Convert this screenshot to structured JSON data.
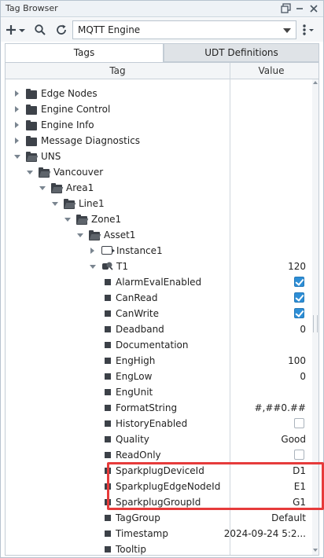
{
  "window": {
    "title": "Tag Browser"
  },
  "toolbar": {
    "provider": "MQTT Engine"
  },
  "tabs": [
    "Tags",
    "UDT Definitions"
  ],
  "columns": {
    "tag": "Tag",
    "value": "Value"
  },
  "colors": {
    "accent": "#2d8ed6",
    "highlight": "#e63b3b"
  },
  "tree": [
    {
      "label": "Edge Nodes",
      "level": 0,
      "icon": "folder-icon",
      "state": "collapsed",
      "value": ""
    },
    {
      "label": "Engine Control",
      "level": 0,
      "icon": "folder-icon",
      "state": "collapsed",
      "value": ""
    },
    {
      "label": "Engine Info",
      "level": 0,
      "icon": "folder-icon",
      "state": "collapsed",
      "value": ""
    },
    {
      "label": "Message Diagnostics",
      "level": 0,
      "icon": "folder-icon",
      "state": "collapsed",
      "value": ""
    },
    {
      "label": "UNS",
      "level": 0,
      "icon": "folder-open-icon",
      "state": "expanded",
      "value": ""
    },
    {
      "label": "Vancouver",
      "level": 1,
      "icon": "folder-open-icon",
      "state": "expanded",
      "value": ""
    },
    {
      "label": "Area1",
      "level": 2,
      "icon": "folder-open-icon",
      "state": "expanded",
      "value": ""
    },
    {
      "label": "Line1",
      "level": 3,
      "icon": "folder-open-icon",
      "state": "expanded",
      "value": ""
    },
    {
      "label": "Zone1",
      "level": 4,
      "icon": "folder-open-icon",
      "state": "expanded",
      "value": ""
    },
    {
      "label": "Asset1",
      "level": 5,
      "icon": "folder-open-icon",
      "state": "expanded",
      "value": ""
    },
    {
      "label": "Instance1",
      "level": 6,
      "icon": "udt-instance-icon",
      "state": "collapsed",
      "value": ""
    },
    {
      "label": "T1",
      "level": 6,
      "icon": "tag-expanded-icon",
      "state": "expanded",
      "value": "120"
    },
    {
      "label": "AlarmEvalEnabled",
      "level": 7,
      "icon": "property-icon",
      "state": "leaf",
      "check": true
    },
    {
      "label": "CanRead",
      "level": 7,
      "icon": "property-icon",
      "state": "leaf",
      "check": true
    },
    {
      "label": "CanWrite",
      "level": 7,
      "icon": "property-icon",
      "state": "leaf",
      "check": true
    },
    {
      "label": "Deadband",
      "level": 7,
      "icon": "property-icon",
      "state": "leaf",
      "value": "0"
    },
    {
      "label": "Documentation",
      "level": 7,
      "icon": "property-icon",
      "state": "leaf",
      "value": ""
    },
    {
      "label": "EngHigh",
      "level": 7,
      "icon": "property-icon",
      "state": "leaf",
      "value": "100"
    },
    {
      "label": "EngLow",
      "level": 7,
      "icon": "property-icon",
      "state": "leaf",
      "value": "0"
    },
    {
      "label": "EngUnit",
      "level": 7,
      "icon": "property-icon",
      "state": "leaf",
      "value": ""
    },
    {
      "label": "FormatString",
      "level": 7,
      "icon": "property-icon",
      "state": "leaf",
      "value": "#,##0.##"
    },
    {
      "label": "HistoryEnabled",
      "level": 7,
      "icon": "property-icon",
      "state": "leaf",
      "check": false
    },
    {
      "label": "Quality",
      "level": 7,
      "icon": "property-icon",
      "state": "leaf",
      "value": "Good"
    },
    {
      "label": "ReadOnly",
      "level": 7,
      "icon": "property-icon",
      "state": "leaf",
      "check": false
    },
    {
      "label": "SparkplugDeviceId",
      "level": 7,
      "icon": "property-icon",
      "state": "leaf",
      "value": "D1"
    },
    {
      "label": "SparkplugEdgeNodeId",
      "level": 7,
      "icon": "property-icon",
      "state": "leaf",
      "value": "E1"
    },
    {
      "label": "SparkplugGroupId",
      "level": 7,
      "icon": "property-icon",
      "state": "leaf",
      "value": "G1"
    },
    {
      "label": "TagGroup",
      "level": 7,
      "icon": "property-icon",
      "state": "leaf",
      "value": "Default"
    },
    {
      "label": "Timestamp",
      "level": 7,
      "icon": "property-icon",
      "state": "leaf",
      "value": "2024-09-24 5:2..."
    },
    {
      "label": "Tooltip",
      "level": 7,
      "icon": "property-icon",
      "state": "leaf",
      "value": ""
    }
  ]
}
